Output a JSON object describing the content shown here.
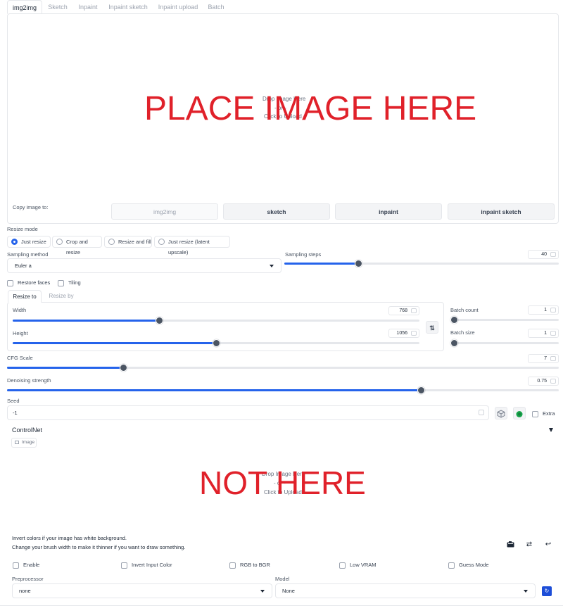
{
  "tabs": [
    "img2img",
    "Sketch",
    "Inpaint",
    "Inpaint sketch",
    "Inpaint upload",
    "Batch"
  ],
  "upload": {
    "drop_text": "Drop Image Here",
    "or_text": "- or -",
    "click_text": "Click to Upload",
    "overlay_text": "PLACE IMAGE HERE"
  },
  "copy_image": {
    "label": "Copy image to:",
    "buttons": [
      "img2img",
      "sketch",
      "inpaint",
      "inpaint sketch"
    ]
  },
  "resize_mode": {
    "label": "Resize mode",
    "options": [
      "Just resize",
      "Crop and resize",
      "Resize and fill",
      "Just resize (latent upscale)"
    ],
    "selected": "Just resize"
  },
  "sampling_method": {
    "label": "Sampling method",
    "value": "Euler a"
  },
  "sampling_steps": {
    "label": "Sampling steps",
    "value": "40",
    "level": 0.27
  },
  "options": {
    "restore_faces": "Restore faces",
    "tiling": "Tiling"
  },
  "resize_tabs": [
    "Resize to",
    "Resize by"
  ],
  "width": {
    "label": "Width",
    "value": "768",
    "level": 0.36
  },
  "height": {
    "label": "Height",
    "value": "1056",
    "level": 0.5
  },
  "swap_icon": "swap-vertical-icon",
  "batch_count": {
    "label": "Batch count",
    "value": "1",
    "level": 0.0
  },
  "batch_size": {
    "label": "Batch size",
    "value": "1",
    "level": 0.0
  },
  "cfg_scale": {
    "label": "CFG Scale",
    "value": "7",
    "level": 0.21
  },
  "denoising": {
    "label": "Denoising strength",
    "value": "0.75",
    "level": 0.75
  },
  "seed": {
    "label": "Seed",
    "value": "-1",
    "extra": "Extra",
    "dice_icon": "dice-icon",
    "recycle_icon": "recycle-icon"
  },
  "controlnet": {
    "title": "ControlNet",
    "image_tab": "Image",
    "drop_text": "Drop Image Here",
    "or_text": "- or -",
    "click_text": "Click to Upload",
    "overlay_text": "NOT HERE",
    "hint1": "Invert colors if your image has white background.",
    "hint2": "Change your brush width to make it thinner if you want to draw something.",
    "checks": [
      "Enable",
      "Invert Input Color",
      "RGB to BGR",
      "Low VRAM",
      "Guess Mode"
    ],
    "preprocessor": {
      "label": "Preprocessor",
      "value": "none"
    },
    "model": {
      "label": "Model",
      "value": "None"
    }
  },
  "colors": {
    "accent": "#2563eb",
    "overlay_red": "#e0212a"
  }
}
